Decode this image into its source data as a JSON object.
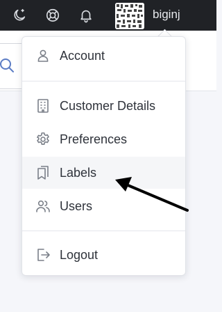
{
  "topbar": {
    "icons": [
      "moon-icon",
      "lifebuoy-icon",
      "bell-icon"
    ],
    "username": "biginj"
  },
  "menu": {
    "items": [
      {
        "label": "Account",
        "icon": "user-icon"
      },
      {
        "label": "Customer Details",
        "icon": "building-icon"
      },
      {
        "label": "Preferences",
        "icon": "gear-icon"
      },
      {
        "label": "Labels",
        "icon": "labels-icon"
      },
      {
        "label": "Users",
        "icon": "users-icon"
      },
      {
        "label": "Logout",
        "icon": "logout-icon"
      }
    ],
    "highlighted": "Labels"
  },
  "colors": {
    "topbar_bg": "#202226",
    "menu_text": "#2e323a",
    "icon_stroke": "#7a7f88",
    "hover_bg": "#f5f6f8",
    "arrow": "#000000"
  }
}
